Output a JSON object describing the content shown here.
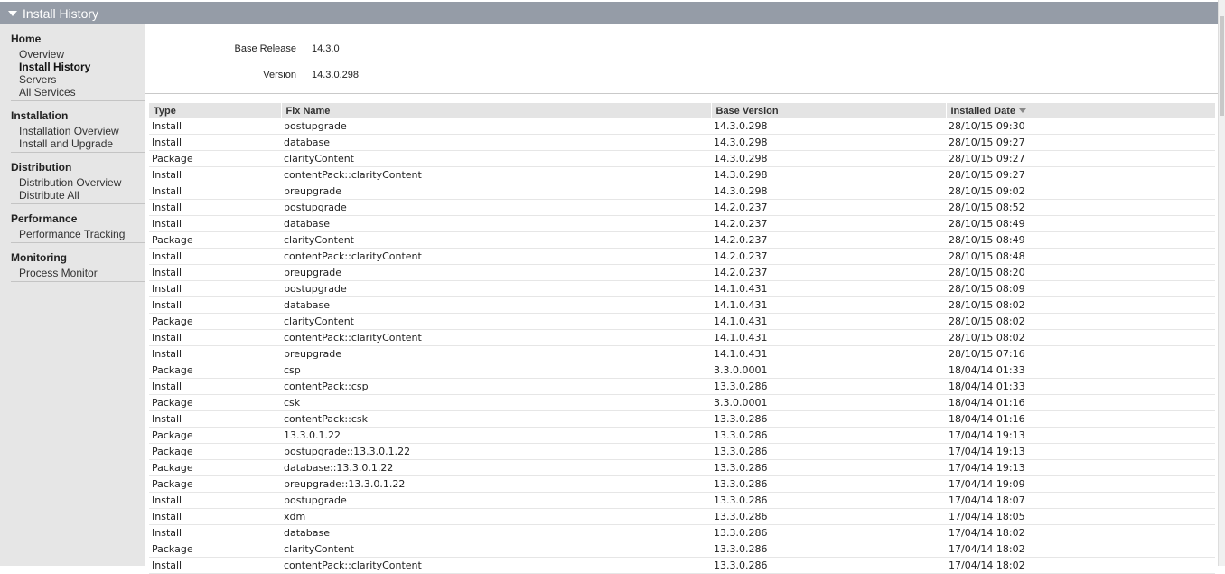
{
  "titlebar": {
    "title": "Install History"
  },
  "sidebar": {
    "sections": [
      {
        "title": "Home",
        "items": [
          "Overview",
          "Install History",
          "Servers",
          "All Services"
        ]
      },
      {
        "title": "Installation",
        "items": [
          "Installation Overview",
          "Install and Upgrade"
        ]
      },
      {
        "title": "Distribution",
        "items": [
          "Distribution Overview",
          "Distribute All"
        ]
      },
      {
        "title": "Performance",
        "items": [
          "Performance Tracking"
        ]
      },
      {
        "title": "Monitoring",
        "items": [
          "Process Monitor"
        ]
      }
    ],
    "active_item": "Install History"
  },
  "summary": {
    "base_release_label": "Base Release",
    "base_release_value": "14.3.0",
    "version_label": "Version",
    "version_value": "14.3.0.298"
  },
  "table": {
    "columns": [
      "Type",
      "Fix Name",
      "Base Version",
      "Installed Date"
    ],
    "sorted_column": "Installed Date",
    "rows": [
      [
        "Install",
        "postupgrade",
        "14.3.0.298",
        "28/10/15 09:30"
      ],
      [
        "Install",
        "database",
        "14.3.0.298",
        "28/10/15 09:27"
      ],
      [
        "Package",
        "clarityContent",
        "14.3.0.298",
        "28/10/15 09:27"
      ],
      [
        "Install",
        "contentPack::clarityContent",
        "14.3.0.298",
        "28/10/15 09:27"
      ],
      [
        "Install",
        "preupgrade",
        "14.3.0.298",
        "28/10/15 09:02"
      ],
      [
        "Install",
        "postupgrade",
        "14.2.0.237",
        "28/10/15 08:52"
      ],
      [
        "Install",
        "database",
        "14.2.0.237",
        "28/10/15 08:49"
      ],
      [
        "Package",
        "clarityContent",
        "14.2.0.237",
        "28/10/15 08:49"
      ],
      [
        "Install",
        "contentPack::clarityContent",
        "14.2.0.237",
        "28/10/15 08:48"
      ],
      [
        "Install",
        "preupgrade",
        "14.2.0.237",
        "28/10/15 08:20"
      ],
      [
        "Install",
        "postupgrade",
        "14.1.0.431",
        "28/10/15 08:09"
      ],
      [
        "Install",
        "database",
        "14.1.0.431",
        "28/10/15 08:02"
      ],
      [
        "Package",
        "clarityContent",
        "14.1.0.431",
        "28/10/15 08:02"
      ],
      [
        "Install",
        "contentPack::clarityContent",
        "14.1.0.431",
        "28/10/15 08:02"
      ],
      [
        "Install",
        "preupgrade",
        "14.1.0.431",
        "28/10/15 07:16"
      ],
      [
        "Package",
        "csp",
        "3.3.0.0001",
        "18/04/14 01:33"
      ],
      [
        "Install",
        "contentPack::csp",
        "13.3.0.286",
        "18/04/14 01:33"
      ],
      [
        "Package",
        "csk",
        "3.3.0.0001",
        "18/04/14 01:16"
      ],
      [
        "Install",
        "contentPack::csk",
        "13.3.0.286",
        "18/04/14 01:16"
      ],
      [
        "Package",
        "13.3.0.1.22",
        "13.3.0.286",
        "17/04/14 19:13"
      ],
      [
        "Package",
        "postupgrade::13.3.0.1.22",
        "13.3.0.286",
        "17/04/14 19:13"
      ],
      [
        "Package",
        "database::13.3.0.1.22",
        "13.3.0.286",
        "17/04/14 19:13"
      ],
      [
        "Package",
        "preupgrade::13.3.0.1.22",
        "13.3.0.286",
        "17/04/14 19:09"
      ],
      [
        "Install",
        "postupgrade",
        "13.3.0.286",
        "17/04/14 18:07"
      ],
      [
        "Install",
        "xdm",
        "13.3.0.286",
        "17/04/14 18:05"
      ],
      [
        "Install",
        "database",
        "13.3.0.286",
        "17/04/14 18:02"
      ],
      [
        "Package",
        "clarityContent",
        "13.3.0.286",
        "17/04/14 18:02"
      ],
      [
        "Install",
        "contentPack::clarityContent",
        "13.3.0.286",
        "17/04/14 18:02"
      ]
    ]
  }
}
